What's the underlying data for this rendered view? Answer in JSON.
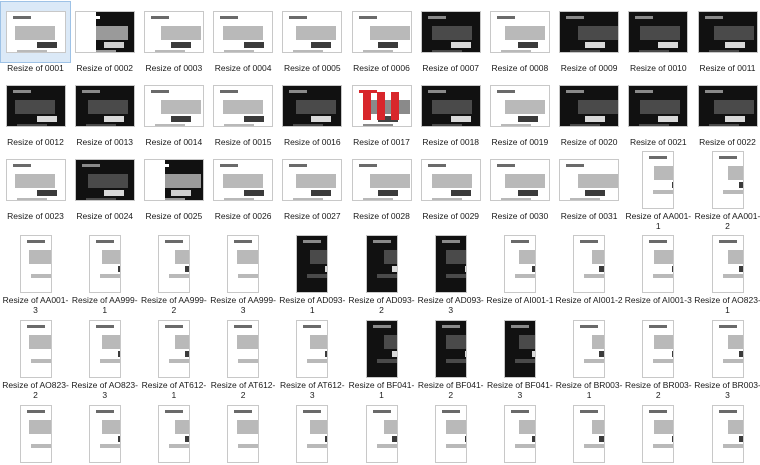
{
  "files": [
    {
      "label": "Resize of 0001",
      "style": "white",
      "orient": "landscape"
    },
    {
      "label": "Resize of 0002",
      "style": "blackwhite",
      "orient": "landscape"
    },
    {
      "label": "Resize of 0003",
      "style": "white",
      "orient": "landscape"
    },
    {
      "label": "Resize of 0004",
      "style": "white",
      "orient": "landscape"
    },
    {
      "label": "Resize of 0005",
      "style": "white",
      "orient": "landscape"
    },
    {
      "label": "Resize of 0006",
      "style": "white",
      "orient": "landscape"
    },
    {
      "label": "Resize of 0007",
      "style": "dark",
      "orient": "landscape"
    },
    {
      "label": "Resize of 0008",
      "style": "white",
      "orient": "landscape"
    },
    {
      "label": "Resize of 0009",
      "style": "dark",
      "orient": "landscape"
    },
    {
      "label": "Resize of 0010",
      "style": "dark",
      "orient": "landscape"
    },
    {
      "label": "Resize of 0011",
      "style": "dark",
      "orient": "landscape"
    },
    {
      "label": "Resize of 0012",
      "style": "dark",
      "orient": "landscape"
    },
    {
      "label": "Resize of 0013",
      "style": "dark",
      "orient": "landscape"
    },
    {
      "label": "Resize of 0014",
      "style": "white",
      "orient": "landscape"
    },
    {
      "label": "Resize of 0015",
      "style": "white",
      "orient": "landscape"
    },
    {
      "label": "Resize of 0016",
      "style": "dark",
      "orient": "landscape"
    },
    {
      "label": "Resize of 0017",
      "style": "red",
      "orient": "landscape"
    },
    {
      "label": "Resize of 0018",
      "style": "dark",
      "orient": "landscape"
    },
    {
      "label": "Resize of 0019",
      "style": "white",
      "orient": "landscape"
    },
    {
      "label": "Resize of 0020",
      "style": "dark",
      "orient": "landscape"
    },
    {
      "label": "Resize of 0021",
      "style": "dark",
      "orient": "landscape"
    },
    {
      "label": "Resize of 0022",
      "style": "dark",
      "orient": "landscape"
    },
    {
      "label": "Resize of 0023",
      "style": "white",
      "orient": "landscape"
    },
    {
      "label": "Resize of 0024",
      "style": "dark",
      "orient": "landscape"
    },
    {
      "label": "Resize of 0025",
      "style": "blackwhite",
      "orient": "landscape"
    },
    {
      "label": "Resize of 0026",
      "style": "white",
      "orient": "landscape"
    },
    {
      "label": "Resize of 0027",
      "style": "white",
      "orient": "landscape"
    },
    {
      "label": "Resize of 0028",
      "style": "white",
      "orient": "landscape"
    },
    {
      "label": "Resize of 0029",
      "style": "white",
      "orient": "landscape"
    },
    {
      "label": "Resize of 0030",
      "style": "white",
      "orient": "landscape"
    },
    {
      "label": "Resize of 0031",
      "style": "white",
      "orient": "landscape"
    },
    {
      "label": "Resize of AA001-1",
      "style": "white",
      "orient": "portrait"
    },
    {
      "label": "Resize of AA001-2",
      "style": "white",
      "orient": "portrait"
    },
    {
      "label": "Resize of AA001-3",
      "style": "white",
      "orient": "portrait"
    },
    {
      "label": "Resize of AA999-1",
      "style": "white",
      "orient": "portrait"
    },
    {
      "label": "Resize of AA999-2",
      "style": "white",
      "orient": "portrait"
    },
    {
      "label": "Resize of AA999-3",
      "style": "white",
      "orient": "portrait"
    },
    {
      "label": "Resize of AD093-1",
      "style": "dark",
      "orient": "portrait"
    },
    {
      "label": "Resize of AD093-2",
      "style": "dark",
      "orient": "portrait"
    },
    {
      "label": "Resize of AD093-3",
      "style": "dark",
      "orient": "portrait"
    },
    {
      "label": "Resize of AI001-1",
      "style": "white",
      "orient": "portrait"
    },
    {
      "label": "Resize of AI001-2",
      "style": "white",
      "orient": "portrait"
    },
    {
      "label": "Resize of AI001-3",
      "style": "white",
      "orient": "portrait"
    },
    {
      "label": "Resize of AO823-1",
      "style": "white",
      "orient": "portrait"
    },
    {
      "label": "Resize of AO823-2",
      "style": "white",
      "orient": "portrait"
    },
    {
      "label": "Resize of AO823-3",
      "style": "white",
      "orient": "portrait"
    },
    {
      "label": "Resize of AT612-1",
      "style": "white",
      "orient": "portrait"
    },
    {
      "label": "Resize of AT612-2",
      "style": "white",
      "orient": "portrait"
    },
    {
      "label": "Resize of AT612-3",
      "style": "white",
      "orient": "portrait"
    },
    {
      "label": "Resize of BF041-1",
      "style": "dark",
      "orient": "portrait"
    },
    {
      "label": "Resize of BF041-2",
      "style": "dark",
      "orient": "portrait"
    },
    {
      "label": "Resize of BF041-3",
      "style": "dark",
      "orient": "portrait"
    },
    {
      "label": "Resize of BR003-1",
      "style": "white",
      "orient": "portrait"
    },
    {
      "label": "Resize of BR003-2",
      "style": "white",
      "orient": "portrait"
    },
    {
      "label": "Resize of BR003-3",
      "style": "white",
      "orient": "portrait"
    },
    {
      "label": "",
      "style": "white",
      "orient": "portrait"
    },
    {
      "label": "",
      "style": "white",
      "orient": "portrait"
    },
    {
      "label": "",
      "style": "white",
      "orient": "portrait"
    },
    {
      "label": "",
      "style": "white",
      "orient": "portrait"
    },
    {
      "label": "",
      "style": "white",
      "orient": "portrait"
    },
    {
      "label": "",
      "style": "white",
      "orient": "portrait"
    },
    {
      "label": "",
      "style": "white",
      "orient": "portrait"
    },
    {
      "label": "",
      "style": "white",
      "orient": "portrait"
    },
    {
      "label": "",
      "style": "white",
      "orient": "portrait"
    },
    {
      "label": "",
      "style": "white",
      "orient": "portrait"
    },
    {
      "label": "",
      "style": "white",
      "orient": "portrait"
    },
    {
      "label": "",
      "style": "white",
      "orient": "portrait"
    }
  ],
  "selected_index": 0,
  "colors": {
    "selection": "#dbe9f7",
    "dark": "#111111",
    "red": "#d8262b",
    "paper": "#ffffff"
  }
}
